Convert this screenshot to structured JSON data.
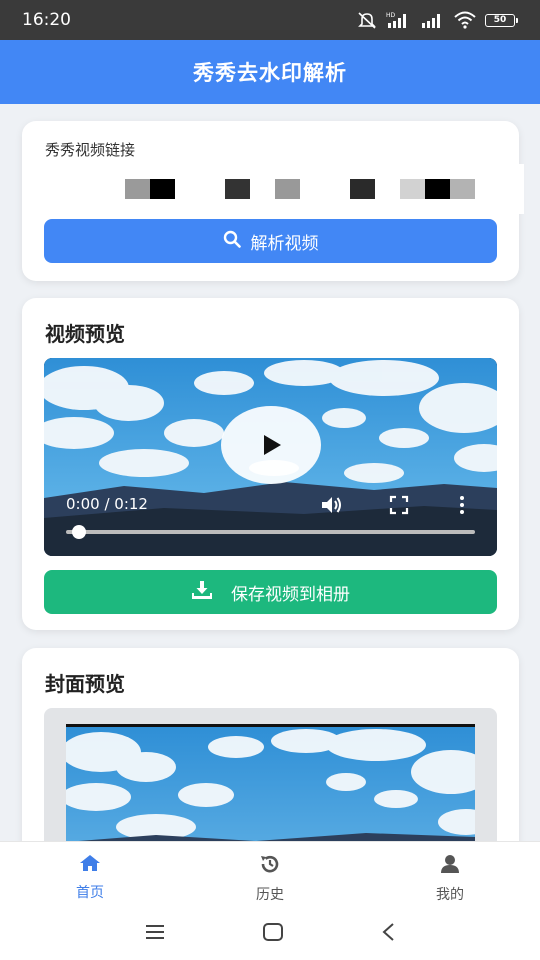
{
  "status_bar": {
    "time": "16:20",
    "battery": "50",
    "icons": [
      "mute-icon",
      "hd-signal-icon",
      "signal-icon",
      "wifi-icon",
      "battery-icon"
    ]
  },
  "header": {
    "title": "秀秀去水印解析"
  },
  "link_card": {
    "label": "秀秀视频链接",
    "parse_button": "解析视频",
    "parse_icon": "search-icon"
  },
  "video_card": {
    "title": "视频预览",
    "time_display": "0:00 / 0:12",
    "progress": 0.02,
    "save_button": "保存视频到相册",
    "save_icon": "download-icon"
  },
  "cover_card": {
    "title": "封面预览"
  },
  "tabs": [
    {
      "label": "首页",
      "icon": "home-icon",
      "active": true
    },
    {
      "label": "历史",
      "icon": "history-icon",
      "active": false
    },
    {
      "label": "我的",
      "icon": "user-icon",
      "active": false
    }
  ],
  "colors": {
    "primary": "#4287f5",
    "success": "#1db87e",
    "background": "#eef1f5"
  }
}
